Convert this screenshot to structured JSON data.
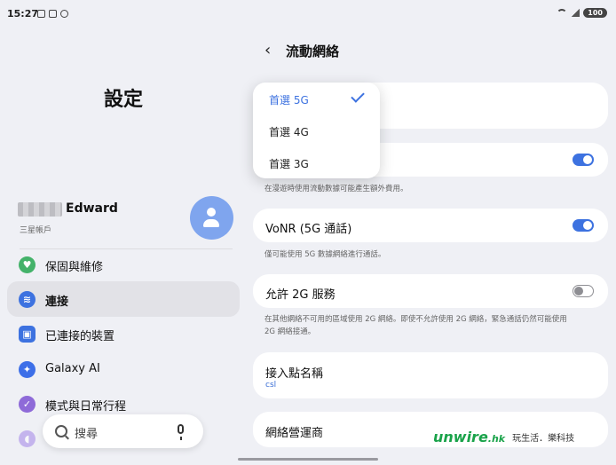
{
  "status": {
    "time": "15:27",
    "battery": "100"
  },
  "left": {
    "title": "設定",
    "account": {
      "name": "Edward",
      "subtitle": "三星帳戶"
    },
    "menu": [
      {
        "label": "保固與維修",
        "icon": "heart-shield-icon",
        "color": "#44b26a"
      },
      {
        "label": "連接",
        "icon": "wifi-icon",
        "color": "#3d72e0"
      },
      {
        "label": "已連接的裝置",
        "icon": "devices-icon",
        "color": "#3d72e0"
      },
      {
        "label": "Galaxy AI",
        "icon": "sparkle-icon",
        "color": "#3d6fe8"
      },
      {
        "label": "模式與日常行程",
        "icon": "check-circle-icon",
        "color": "#8e6ad8"
      }
    ],
    "search_placeholder": "搜尋"
  },
  "right": {
    "title": "流動網絡",
    "dropdown": {
      "options": [
        "首選 5G",
        "首選 4G",
        "首選 3G"
      ],
      "selected": "首選 5G"
    },
    "roaming_desc": "在漫遊時使用流動數據可能產生額外費用。",
    "vonr": {
      "label": "VoNR (5G 通話)",
      "on": true,
      "desc": "僅可能使用 5G 數據網絡進行通話。"
    },
    "allow2g": {
      "label": "允許 2G 服務",
      "on": false,
      "desc_line1": "在其他網絡不可用的區域使用 2G 網絡。即使不允許使用 2G 網絡，緊急通話仍然可能使用",
      "desc_line2": "2G 網絡接通。"
    },
    "apn": {
      "label": "接入點名稱",
      "value": "csl"
    },
    "operator": {
      "label": "網絡營運商"
    }
  },
  "watermark": {
    "logo": "unwire",
    "logo_suffix": ".hk",
    "tagline": "玩生活．樂科技"
  },
  "colors": {
    "accent": "#3d72e0",
    "background": "#eff0f5"
  }
}
